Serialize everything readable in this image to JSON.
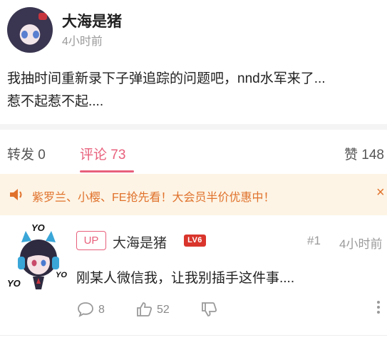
{
  "post": {
    "author": "大海是猪",
    "time": "4小时前",
    "content_line1": "我抽时间重新录下子弹追踪的问题吧，nnd水军来了...",
    "content_line2": "惹不起惹不起...."
  },
  "tabs": {
    "repost": "转发 0",
    "comment": "评论 73",
    "like": "赞 148"
  },
  "notice": {
    "text": "紫罗兰、小樱、FE抢先看！大会员半价优惠中！",
    "close": "×"
  },
  "comment": {
    "badge": "UP",
    "name": "大海是猪",
    "level": "LV6",
    "floor": "#1",
    "time": "4小时前",
    "text": "刚某人微信我，让我别插手这件事....",
    "reply_count": "8",
    "like_count": "52"
  },
  "avatar_text": {
    "yo_top": "YO",
    "yo_bottom": "YO",
    "yo_right": "YO"
  },
  "colors": {
    "accent": "#e8607c",
    "notice_bg": "#fdf4e5",
    "notice_text": "#e0722c",
    "level_badge": "#d9352c"
  }
}
